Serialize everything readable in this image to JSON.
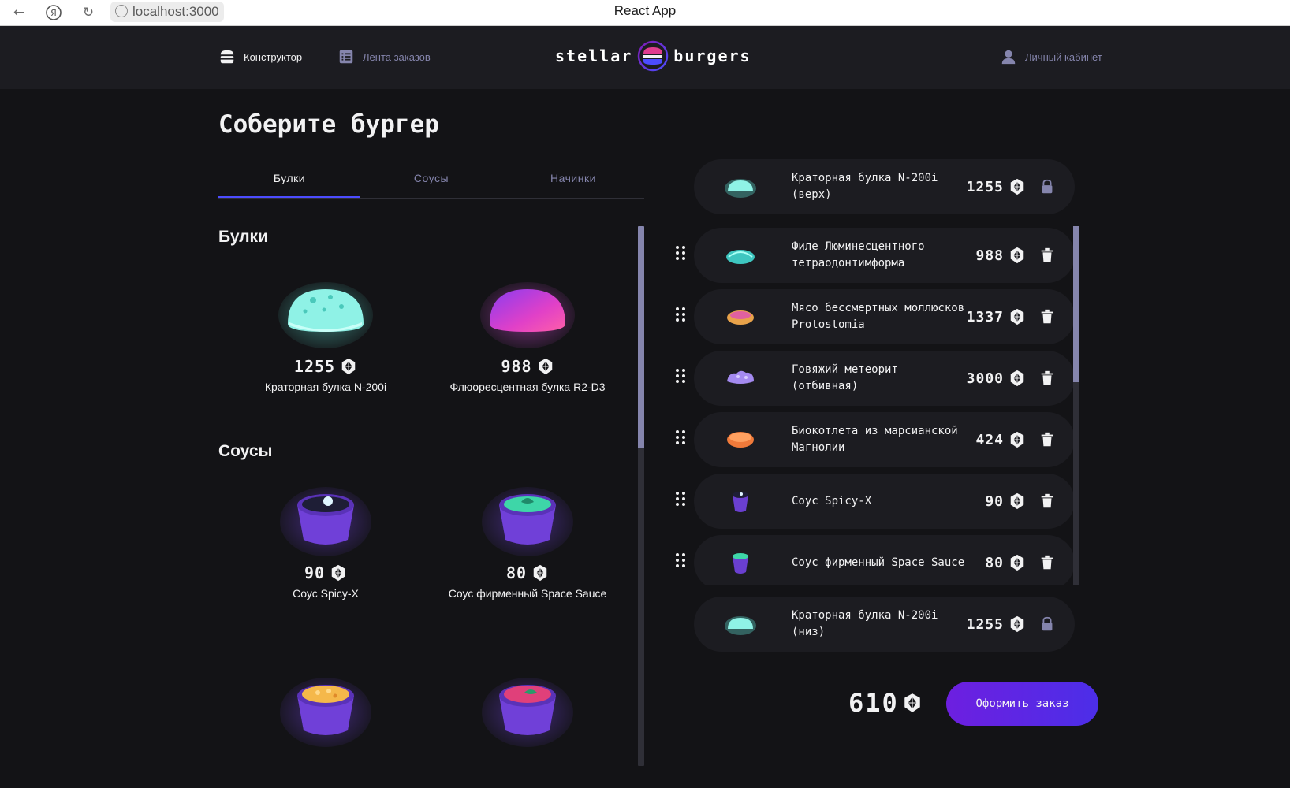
{
  "browser": {
    "url": "localhost:3000",
    "title": "React App"
  },
  "header": {
    "nav_constructor": "Конструктор",
    "nav_feed": "Лента заказов",
    "logo_left": "stellar",
    "logo_right": "burgers",
    "nav_account": "Личный кабинет"
  },
  "constructor": {
    "title": "Соберите бургер",
    "tabs": [
      "Булки",
      "Соусы",
      "Начинки"
    ],
    "active_tab": "Булки",
    "sections": {
      "buns_title": "Булки",
      "sauces_title": "Соусы"
    },
    "buns": [
      {
        "name": "Краторная булка N-200i",
        "price": "1255",
        "color": "#5fe6d6"
      },
      {
        "name": "Флюоресцентная булка R2-D3",
        "price": "988",
        "color": "#d44bd8"
      }
    ],
    "sauces": [
      {
        "name": "Соус Spicy-X",
        "price": "90",
        "color": "#2a2a4a"
      },
      {
        "name": "Соус фирменный Space Sauce",
        "price": "80",
        "color": "#3ed6a8"
      },
      {
        "name": "",
        "price": "",
        "color": "#f5b84a"
      },
      {
        "name": "",
        "price": "",
        "color": "#e0407a"
      }
    ]
  },
  "burger": {
    "top": {
      "name": "Краторная булка N-200i (верх)",
      "price": "1255",
      "color": "#5fe6d6"
    },
    "fillings": [
      {
        "name": "Филе Люминесцентного тетраодонтимформа",
        "price": "988",
        "color": "#3ec6c0"
      },
      {
        "name": "Мясо бессмертных моллюсков Protostomia",
        "price": "1337",
        "color": "#e8a24a"
      },
      {
        "name": "Говяжий метеорит (отбивная)",
        "price": "3000",
        "color": "#a48af0"
      },
      {
        "name": "Биокотлета из марсианской Магнолии",
        "price": "424",
        "color": "#f07a3a"
      },
      {
        "name": "Соус Spicy-X",
        "price": "90",
        "color": "#6a3fd0"
      },
      {
        "name": "Соус фирменный Space Sauce",
        "price": "80",
        "color": "#3ed6a8"
      }
    ],
    "bottom": {
      "name": "Краторная булка N-200i (низ)",
      "price": "1255",
      "color": "#5fe6d6"
    },
    "total": "610",
    "order_button": "Оформить заказ"
  },
  "colors": {
    "accent": "#4c4cff",
    "background": "#131316",
    "panel": "#1c1c21",
    "inactive": "#8585ad"
  }
}
